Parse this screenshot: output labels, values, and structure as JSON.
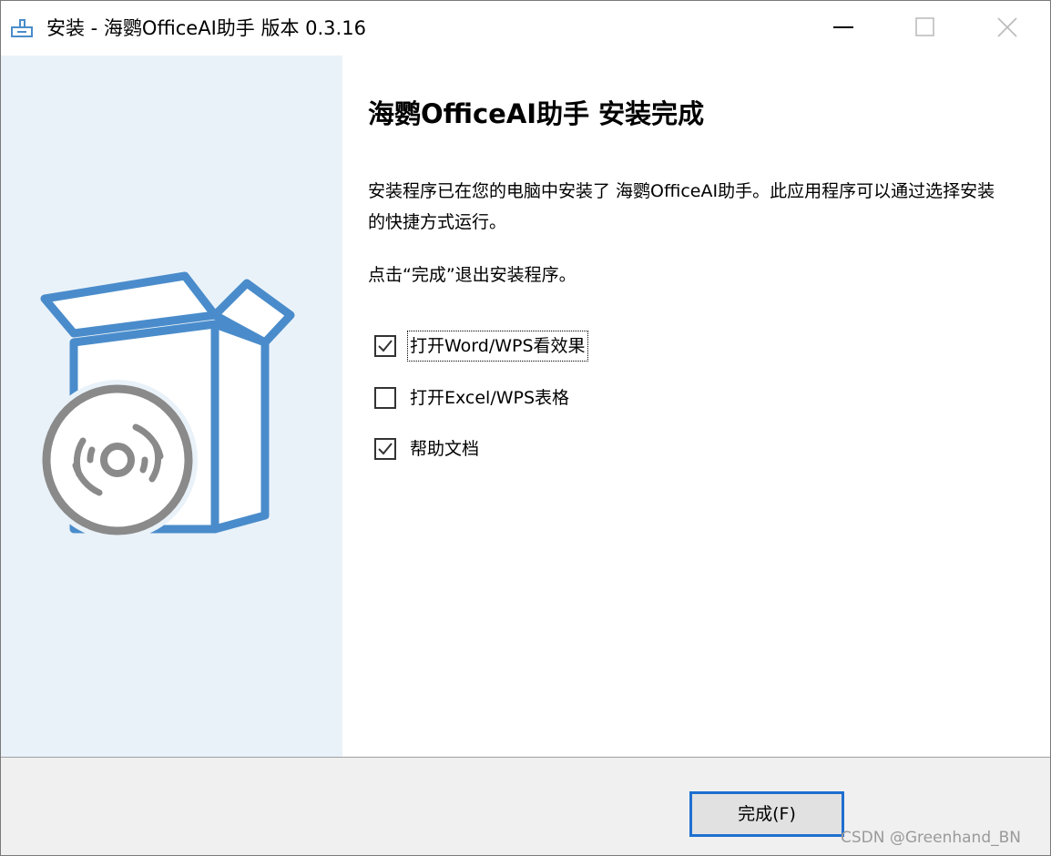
{
  "window": {
    "title": "安装 - 海鹦OfficeAI助手 版本 0.3.16",
    "app_icon": "installer-icon",
    "controls": {
      "minimize": "minimize-icon",
      "maximize": "maximize-icon",
      "close": "close-icon"
    }
  },
  "side_panel": {
    "illustration": "software-box-with-disc",
    "background_color": "#eaf2f9",
    "accent_color": "#4a8ccb"
  },
  "content": {
    "heading": "海鹦OfficeAI助手 安装完成",
    "paragraph1": "安装程序已在您的电脑中安装了 海鹦OfficeAI助手。此应用程序可以通过选择安装的快捷方式运行。",
    "paragraph2": "点击“完成”退出安装程序。",
    "options": [
      {
        "label": "打开Word/WPS看效果",
        "checked": true,
        "focused": true
      },
      {
        "label": "打开Excel/WPS表格",
        "checked": false,
        "focused": false
      },
      {
        "label": "帮助文档",
        "checked": true,
        "focused": false
      }
    ]
  },
  "footer": {
    "finish_button": "完成(F)",
    "accent_color": "#1f6fd0"
  },
  "watermark": "CSDN @Greenhand_BN"
}
